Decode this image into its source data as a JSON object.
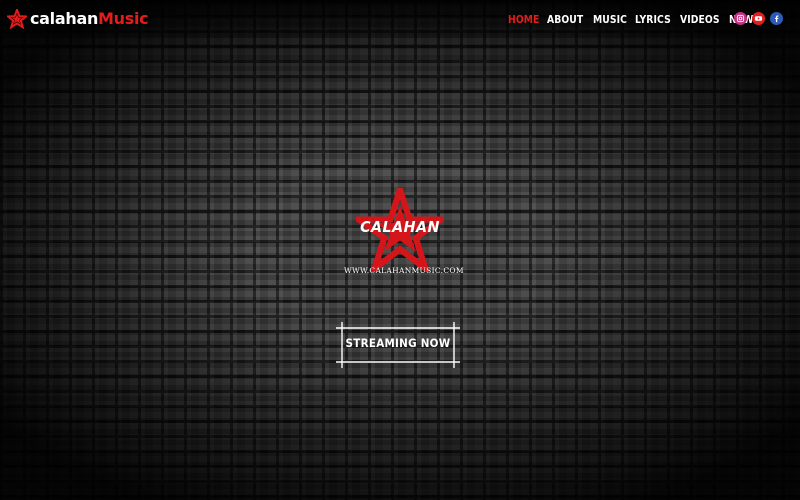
{
  "brand": {
    "name_part1": "calahan",
    "name_part2": "Music",
    "accent_color": "#e31c1c",
    "icon": "star-icon"
  },
  "nav": {
    "items": [
      {
        "label": "HOME",
        "active": true
      },
      {
        "label": "ABOUT",
        "active": false
      },
      {
        "label": "MUSIC",
        "active": false
      },
      {
        "label": "LYRICS",
        "active": false
      },
      {
        "label": "VIDEOS",
        "active": false
      },
      {
        "label": "NEWS",
        "active": false
      }
    ]
  },
  "social": [
    {
      "name": "instagram-icon",
      "color": "#c2307f"
    },
    {
      "name": "youtube-icon",
      "color": "#e02020"
    },
    {
      "name": "facebook-icon",
      "color": "#2d5bb8"
    }
  ],
  "hero": {
    "logo_word": "CALAHAN",
    "logo_url": "WWW.CALAHANMUSIC.COM",
    "cta_label": "STREAMING NOW"
  }
}
